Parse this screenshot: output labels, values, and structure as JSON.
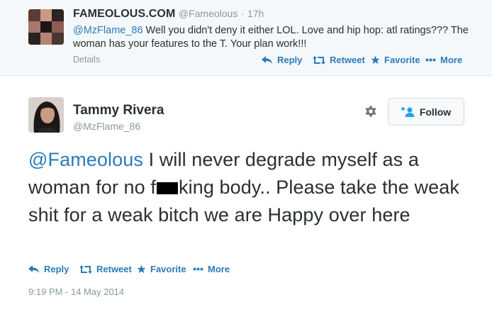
{
  "context_tweet": {
    "fullname": "FAMEOLOUS.COM",
    "handle": "@Fameolous",
    "separator": "·",
    "time": "17h",
    "mention": "@MzFlame_86",
    "text": " Well you didn't deny it either LOL. Love and hip hop: atl ratings??? The woman has your features to the T. Your plan work!!!",
    "details_label": "Details",
    "actions": {
      "reply": "Reply",
      "retweet": "Retweet",
      "favorite": "Favorite",
      "more": "More"
    }
  },
  "tweet": {
    "fullname": "Tammy Rivera",
    "handle": "@MzFlame_86",
    "follow_label": "Follow",
    "mention": "@Fameolous",
    "text_part1": " I will never degrade myself as a woman for no f",
    "text_part2": "king body.. Please take the weak shit for a weak bitch we are Happy over here",
    "actions": {
      "reply": "Reply",
      "retweet": "Retweet",
      "favorite": "Favorite",
      "more": "More"
    },
    "timestamp": "9:19 PM - 14 May 2014"
  },
  "icons": {
    "reply": "reply-icon",
    "retweet": "retweet-icon",
    "favorite": "star-icon",
    "more": "more-dots-icon",
    "settings": "gear-icon",
    "follow": "add-user-icon"
  },
  "colors": {
    "link": "#2b7bb9",
    "muted": "#8899a6",
    "text": "#292f33",
    "context_bg": "#f5f8fa"
  }
}
